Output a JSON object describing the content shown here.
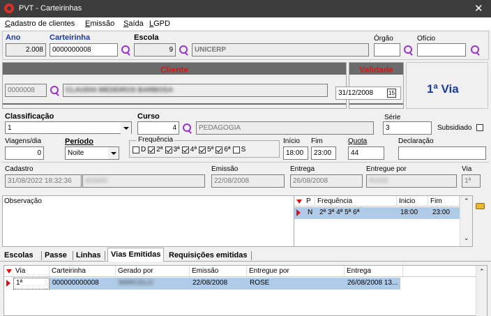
{
  "window": {
    "title": "PVT - Carteirinhas",
    "close_glyph": "✕"
  },
  "menu": [
    "Cadastro de clientes",
    "Emissão",
    "Saída",
    "LGPD"
  ],
  "menu_underline": [
    "C",
    "E",
    "S",
    "L"
  ],
  "ano": {
    "label": "Ano",
    "value": "2.008"
  },
  "carteirinha": {
    "label": "Carteirinha",
    "value": "0000000008"
  },
  "escola": {
    "label": "Escola",
    "code": "9",
    "name": "UNICERP"
  },
  "orgao": {
    "label": "Órgão",
    "value": ""
  },
  "oficio": {
    "label": "Ofício",
    "value": ""
  },
  "cliente": {
    "header": "Cliente",
    "code": "0000008",
    "name": "CLAUDIA MEDEIROS BARBOSA"
  },
  "validade": {
    "header": "Validade",
    "date": "31/12/2008",
    "cal_icon": "15"
  },
  "via_label": "1ª Via",
  "classificacao": {
    "label": "Classificação",
    "value": "1"
  },
  "curso": {
    "label": "Curso",
    "code": "4",
    "name": "PEDAGOGIA"
  },
  "serie": {
    "label": "Série",
    "value": "3"
  },
  "subsidiado": {
    "label": "Subsidiado",
    "checked": false
  },
  "viagens": {
    "label": "Viagens/dia",
    "value": "0"
  },
  "periodo": {
    "label": "Período",
    "value": "Noite"
  },
  "frequencia": {
    "label": "Frequência",
    "days": [
      {
        "label": "D",
        "checked": false
      },
      {
        "label": "2ª",
        "checked": true
      },
      {
        "label": "3ª",
        "checked": true
      },
      {
        "label": "4ª",
        "checked": true
      },
      {
        "label": "5ª",
        "checked": true
      },
      {
        "label": "6ª",
        "checked": true
      },
      {
        "label": "S",
        "checked": false
      }
    ]
  },
  "inicio": {
    "label": "Início",
    "value": "18:00"
  },
  "fim": {
    "label": "Fim",
    "value": "23:00"
  },
  "quota": {
    "label": "Quota",
    "value": "44"
  },
  "declaracao": {
    "label": "Declaração",
    "value": ""
  },
  "cadastro": {
    "label": "Cadastro",
    "value": "31/08/2022 18:32:36",
    "user": "ADMIN"
  },
  "emissao": {
    "label": "Emissão",
    "value": "22/08/2008"
  },
  "entrega": {
    "label": "Entrega",
    "value": "26/08/2008"
  },
  "entregue_por": {
    "label": "Entregue por",
    "value": "ROSE"
  },
  "via": {
    "label": "Via",
    "value": "1ª"
  },
  "observacao": {
    "label": "Observação",
    "value": ""
  },
  "freq_grid": {
    "columns": [
      "P",
      "Frequência",
      "Inicio",
      "Fim"
    ],
    "rows": [
      {
        "p": "N",
        "freq": "2ª 3ª 4ª 5ª 6ª",
        "inicio": "18:00",
        "fim": "23:00"
      }
    ]
  },
  "tabs": [
    "Escolas",
    "Passe",
    "Linhas",
    "Vias Emitidas",
    "Requisições emitidas"
  ],
  "active_tab": "Vias Emitidas",
  "vias_grid": {
    "columns": [
      "Via",
      "Carteirinha",
      "Gerado por",
      "Emissão",
      "Entregue por",
      "Entrega"
    ],
    "rows": [
      {
        "via": "1ª",
        "carteirinha": "000000000008",
        "gerado": "MARCELO",
        "emissao": "22/08/2008",
        "entregue": "ROSE",
        "entrega": "26/08/2008 13..."
      }
    ]
  },
  "colors": {
    "accent": "#1a3a9c",
    "header_red": "#cc1b1b",
    "search_icon": "#9b33d0",
    "selection": "#b0cbe8"
  }
}
